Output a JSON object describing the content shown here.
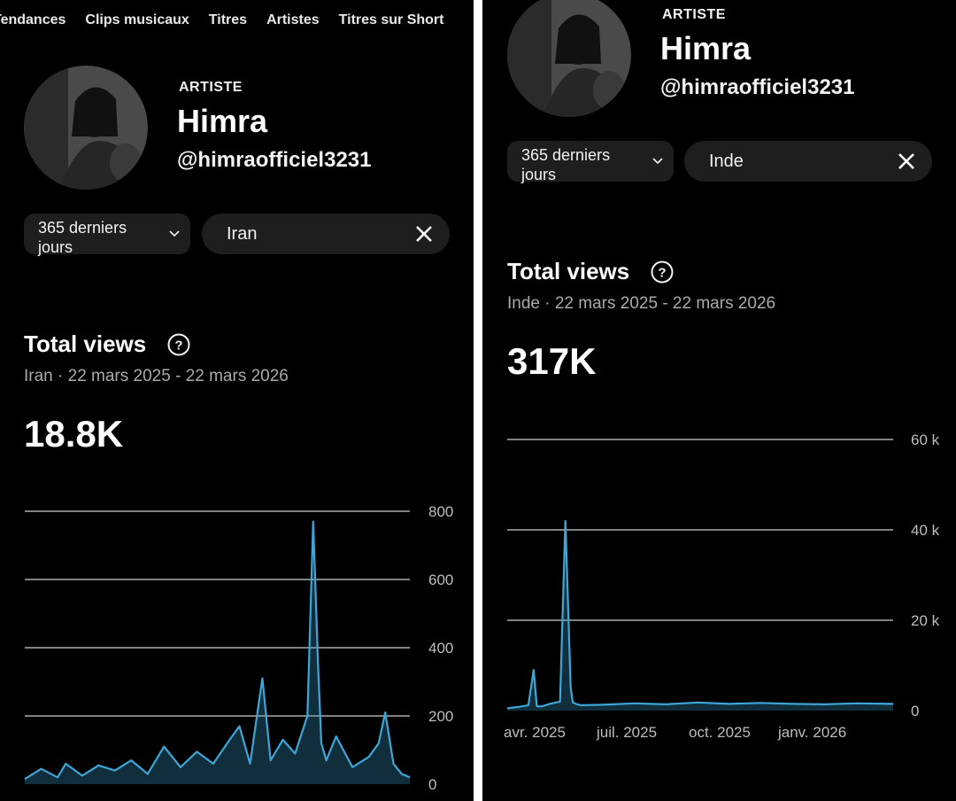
{
  "panels": [
    {
      "nav_tabs": [
        "Tendances",
        "Clips musicaux",
        "Titres",
        "Artistes",
        "Titres sur Short"
      ],
      "profile": {
        "kicker": "ARTISTE",
        "name": "Himra",
        "handle": "@himraofficiel3231"
      },
      "filters": {
        "period": "365 derniers jours",
        "country": "Iran",
        "chevron_icon": "chevron-down-icon",
        "clear_icon": "close-icon"
      },
      "metric": {
        "title": "Total views",
        "help_icon": "help-circle-icon",
        "subtitle": "Iran · 22 mars 2025 - 22 mars 2026",
        "value": "18.8K"
      }
    },
    {
      "profile": {
        "kicker": "ARTISTE",
        "name": "Himra",
        "handle": "@himraofficiel3231"
      },
      "filters": {
        "period": "365 derniers jours",
        "country": "Inde",
        "chevron_icon": "chevron-down-icon",
        "clear_icon": "close-icon"
      },
      "metric": {
        "title": "Total views",
        "help_icon": "help-circle-icon",
        "subtitle": "Inde · 22 mars 2025 - 22 mars 2026",
        "value": "317K"
      }
    }
  ],
  "chart_data": [
    {
      "type": "line",
      "title": "Total views",
      "ylim": [
        0,
        800
      ],
      "ytick_labels": [
        "0",
        "200",
        "400",
        "600",
        "800"
      ],
      "xtick_labels": [],
      "grid": true,
      "line_color": "#3ea6d6",
      "x": [
        0,
        20,
        40,
        50,
        70,
        90,
        110,
        130,
        150,
        170,
        190,
        210,
        230,
        250,
        262,
        275,
        290,
        300,
        315,
        330,
        345,
        352,
        358,
        362,
        368,
        380,
        400,
        420,
        432,
        440,
        450,
        460,
        470
      ],
      "series": [
        {
          "values": [
            15,
            45,
            20,
            60,
            25,
            55,
            40,
            70,
            30,
            110,
            50,
            95,
            60,
            130,
            170,
            60,
            310,
            70,
            130,
            90,
            200,
            770,
            350,
            120,
            70,
            140,
            50,
            80,
            120,
            210,
            60,
            30,
            20
          ]
        }
      ]
    },
    {
      "type": "line",
      "title": "Total views",
      "ylim": [
        0,
        60000
      ],
      "ytick_labels": [
        "0",
        "20 k",
        "40 k",
        "60 k"
      ],
      "xtick_labels": [
        "avr. 2025",
        "juil. 2025",
        "oct. 2025",
        "janv. 2026"
      ],
      "grid": true,
      "line_color": "#3ea6d6",
      "x": [
        0,
        10,
        20,
        25,
        28,
        31,
        35,
        40,
        50,
        55,
        58,
        60,
        62,
        65,
        70,
        90,
        120,
        150,
        180,
        210,
        240,
        270,
        300,
        330,
        365
      ],
      "series": [
        {
          "values": [
            500,
            800,
            1200,
            9000,
            1000,
            900,
            1100,
            1500,
            2000,
            42000,
            20000,
            5000,
            1800,
            1500,
            1200,
            1300,
            1600,
            1400,
            1800,
            1500,
            1700,
            1500,
            1400,
            1600,
            1500
          ]
        }
      ]
    }
  ]
}
